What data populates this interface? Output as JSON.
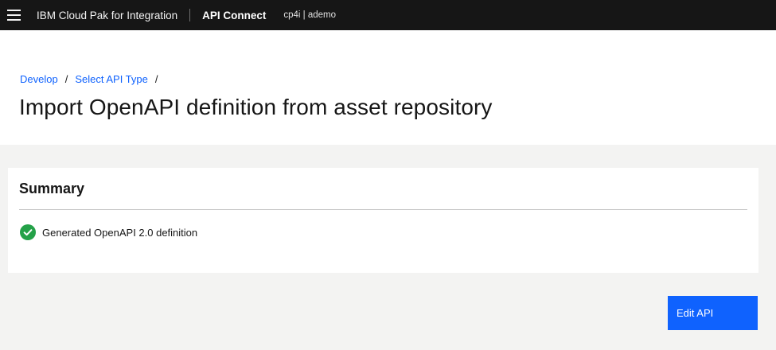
{
  "topbar": {
    "menu_icon": "hamburger-menu-icon",
    "brand": "IBM Cloud Pak for Integration",
    "product": "API Connect",
    "context": "cp4i | ademo"
  },
  "breadcrumb": {
    "items": [
      {
        "label": "Develop"
      },
      {
        "label": "Select API Type"
      }
    ],
    "separator": "/"
  },
  "page": {
    "title": "Import OpenAPI definition from asset repository"
  },
  "summary": {
    "title": "Summary",
    "items": [
      {
        "icon": "checkmark-filled-icon",
        "status_color": "#24a148",
        "text": "Generated OpenAPI 2.0 definition"
      }
    ]
  },
  "actions": {
    "edit_label": "Edit API"
  },
  "colors": {
    "accent": "#0f62fe",
    "topbar": "#161616",
    "success": "#24a148"
  }
}
